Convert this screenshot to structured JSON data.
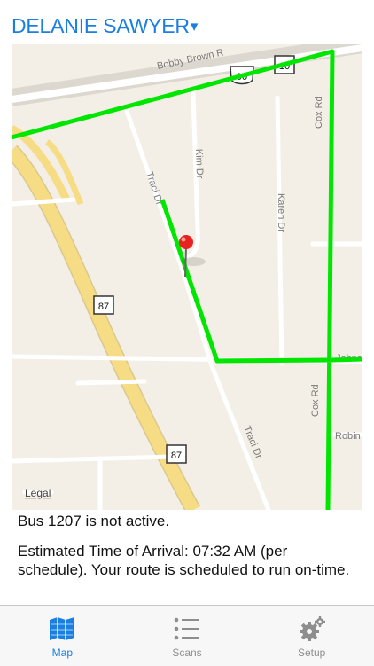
{
  "header": {
    "title": "DELANIE SAWYER",
    "caret": "▾"
  },
  "map": {
    "labels": {
      "bobby_brown": "Bobby Brown R",
      "hwy90": "90",
      "hwy10": "10",
      "cox_rd_top": "Cox Rd",
      "traci_dr_top": "Traci Dr",
      "kim_dr": "Kim Dr",
      "karen_dr": "Karen Dr",
      "hwy87_upper": "87",
      "hwy87_lower": "87",
      "johns": "Johns",
      "cox_rd_bottom": "Cox Rd",
      "traci_dr_bottom": "Traci Dr",
      "robin": "Robin",
      "legal": "Legal"
    },
    "colors": {
      "route": "#00e600",
      "pin": "#e8221e",
      "road": "#ffffff",
      "highway": "#f7dc86"
    }
  },
  "info": {
    "status": "Bus 1207 is not active.",
    "eta": "Estimated Time of Arrival: 07:32 AM (per schedule). Your route is scheduled to run on-time."
  },
  "tabs": [
    {
      "label": "Map",
      "icon": "map-icon",
      "active": true
    },
    {
      "label": "Scans",
      "icon": "list-icon",
      "active": false
    },
    {
      "label": "Setup",
      "icon": "gears-icon",
      "active": false
    }
  ],
  "accent": "#1a7fe0"
}
